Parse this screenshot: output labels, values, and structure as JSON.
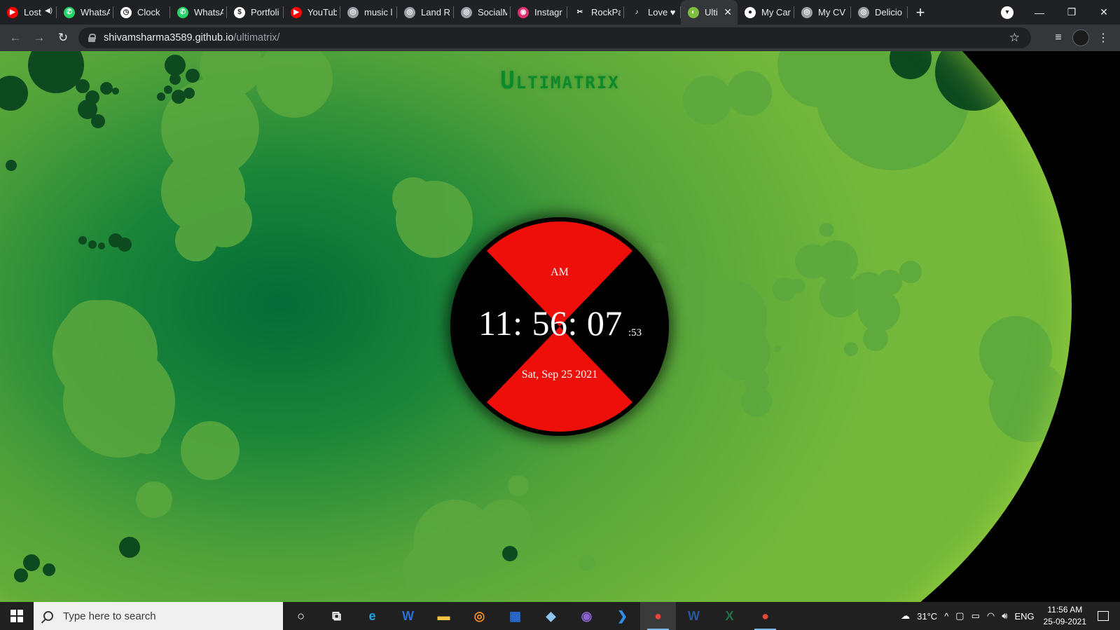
{
  "browser": {
    "tabs": [
      {
        "label": "Lost",
        "favicon": "youtube-icon",
        "color": "#ff0000",
        "glyph": "▶",
        "audio": true
      },
      {
        "label": "WhatsA",
        "favicon": "whatsapp-icon",
        "color": "#25d366",
        "glyph": "✆"
      },
      {
        "label": "Clock",
        "favicon": "clock-icon",
        "color": "#ffffff",
        "glyph": "◷"
      },
      {
        "label": "WhatsA",
        "favicon": "whatsapp-icon",
        "color": "#25d366",
        "glyph": "✆"
      },
      {
        "label": "Portfoli",
        "favicon": "dollar-icon",
        "color": "#ffffff",
        "glyph": "$"
      },
      {
        "label": "YouTub",
        "favicon": "youtube-icon",
        "color": "#ff0000",
        "glyph": "▶"
      },
      {
        "label": "music l",
        "favicon": "globe-icon",
        "color": "#9aa0a6",
        "glyph": "◎"
      },
      {
        "label": "Land Re",
        "favicon": "globe-icon",
        "color": "#9aa0a6",
        "glyph": "◎"
      },
      {
        "label": "SocialM",
        "favicon": "globe-icon",
        "color": "#9aa0a6",
        "glyph": "◎"
      },
      {
        "label": "Instagr",
        "favicon": "instagram-icon",
        "color": "#e1306c",
        "glyph": "◉"
      },
      {
        "label": "RockPa",
        "favicon": "rockpaper-icon",
        "color": "#202124",
        "glyph": "✂"
      },
      {
        "label": "Love ♥",
        "favicon": "love-icon",
        "color": "#202124",
        "glyph": "♪"
      },
      {
        "label": "Ulti",
        "favicon": "ultimatrix-icon",
        "color": "#7fbf3f",
        "glyph": "◐",
        "active": true
      },
      {
        "label": "My Car",
        "favicon": "chrome-app-icon",
        "color": "#ffffff",
        "glyph": "●"
      },
      {
        "label": "My CV",
        "favicon": "globe-icon",
        "color": "#9aa0a6",
        "glyph": "◎"
      },
      {
        "label": "Delicio",
        "favicon": "globe-icon",
        "color": "#9aa0a6",
        "glyph": "◎"
      }
    ],
    "url_host": "shivamsharma3589.github.io",
    "url_path": "/ultimatrix/"
  },
  "page": {
    "title": "Ultimatrix",
    "clock": {
      "meridiem": "AM",
      "time": "11: 56: 07",
      "ms": ":53",
      "date": "Sat, Sep 25 2021",
      "face_color": "#000000",
      "wedge_color": "#ee0f0a"
    }
  },
  "taskbar": {
    "search_placeholder": "Type here to search",
    "apps": [
      {
        "name": "cortana-icon",
        "glyph": "○",
        "color": "#ffffff"
      },
      {
        "name": "task-view-icon",
        "glyph": "⧉",
        "color": "#ffffff"
      },
      {
        "name": "edge-icon",
        "glyph": "e",
        "color": "#1fa3e0"
      },
      {
        "name": "wavepad-icon",
        "glyph": "W",
        "color": "#2b6fd6"
      },
      {
        "name": "file-explorer-icon",
        "glyph": "▬",
        "color": "#f4c542"
      },
      {
        "name": "media-player-icon",
        "glyph": "◎",
        "color": "#f08a24"
      },
      {
        "name": "calculator-icon",
        "glyph": "▦",
        "color": "#2b6fd6"
      },
      {
        "name": "paint-icon",
        "glyph": "◆",
        "color": "#8ec6f0"
      },
      {
        "name": "github-icon",
        "glyph": "◉",
        "color": "#8a63d2"
      },
      {
        "name": "vscode-icon",
        "glyph": "❯",
        "color": "#2f8ee8"
      },
      {
        "name": "chrome-icon",
        "glyph": "●",
        "color": "#e8453c",
        "active": true
      },
      {
        "name": "word-icon",
        "glyph": "W",
        "color": "#2b579a"
      },
      {
        "name": "excel-icon",
        "glyph": "X",
        "color": "#217346"
      },
      {
        "name": "chrome-profile-icon",
        "glyph": "●",
        "color": "#e8453c",
        "running": true
      }
    ],
    "weather": "31°C",
    "language": "ENG",
    "time": "11:56 AM",
    "date": "25-09-2021"
  }
}
